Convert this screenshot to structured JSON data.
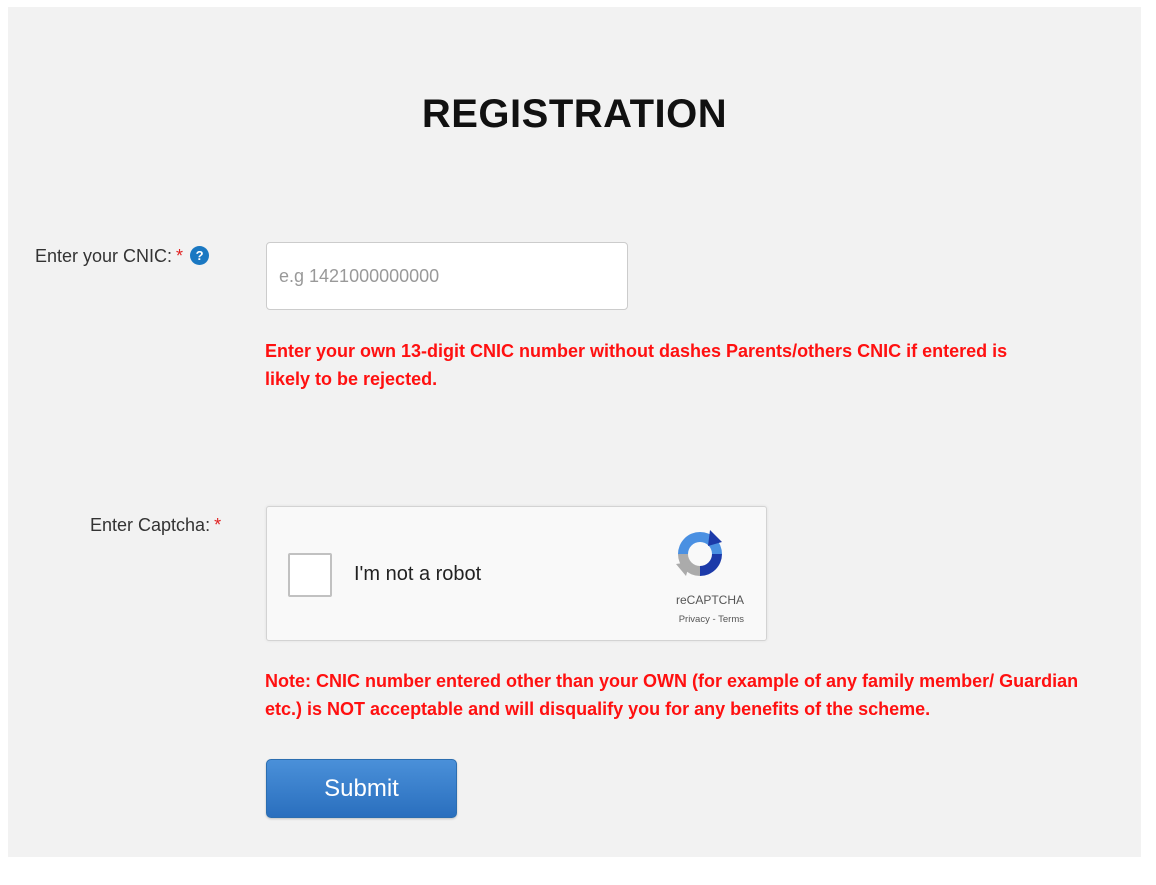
{
  "page": {
    "title": "REGISTRATION"
  },
  "cnic": {
    "label": "Enter your CNIC:",
    "required_mark": "*",
    "help_icon": "question-circle-icon",
    "placeholder": "e.g 1421000000000",
    "value": "",
    "warning": "Enter your own 13-digit CNIC number without dashes Parents/others CNIC if entered is likely to be rejected."
  },
  "captcha": {
    "label": "Enter Captcha:",
    "required_mark": "*",
    "checkbox_text": "I'm not a robot",
    "checked": false,
    "brand": "reCAPTCHA",
    "privacy_link": "Privacy",
    "separator": " - ",
    "terms_link": "Terms",
    "logo_icon": "recaptcha-logo-icon"
  },
  "note": "Note: CNIC number entered other than your OWN (for example of any family member/ Guardian etc.) is NOT acceptable and will disqualify you for any benefits of the scheme.",
  "submit": {
    "label": "Submit"
  },
  "colors": {
    "panel_bg": "#f2f2f2",
    "warning_text": "#ff1010",
    "required_mark": "#e02020",
    "help_icon": "#1a78c2",
    "button_top": "#4a90d9",
    "button_bottom": "#2a6fbe"
  }
}
